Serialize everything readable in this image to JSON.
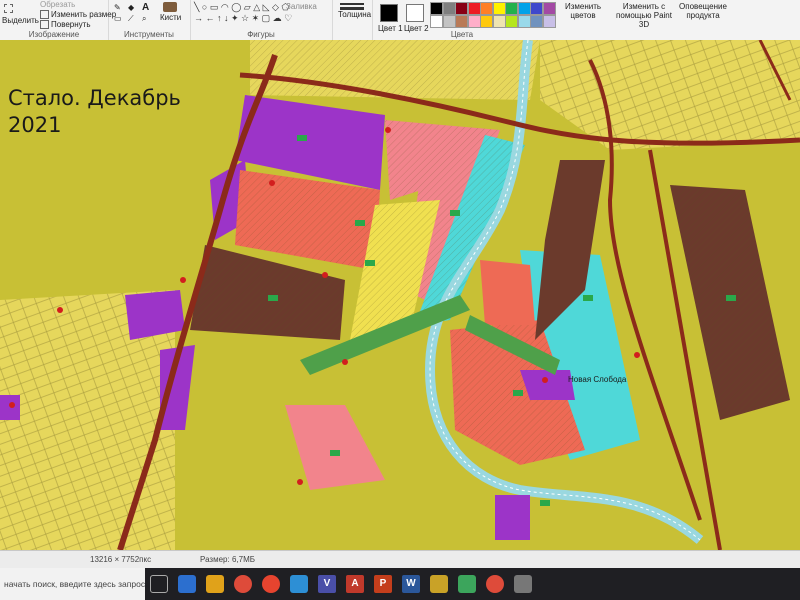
{
  "ribbon": {
    "image_group": {
      "label": "Изображение",
      "select": "Выделить",
      "crop": "Обрезать",
      "resize": "Изменить размер",
      "rotate": "Повернуть"
    },
    "tools_group": {
      "label": "Инструменты",
      "brushes": "Кисти",
      "text_tool": "A"
    },
    "shapes_group": {
      "label": "Фигуры",
      "fill": "Заливка"
    },
    "size": {
      "label": "Толщина"
    },
    "colors_group": {
      "label": "Цвета",
      "color1": "Цвет 1",
      "color2": "Цвет 2",
      "edit_colors": "Изменить цветов",
      "paint3d": "Изменить с помощью Paint 3D",
      "product_alert": "Оповещение продукта"
    },
    "palette": [
      "#000000",
      "#7f7f7f",
      "#880015",
      "#ed1c24",
      "#ff7f27",
      "#fff200",
      "#22b14c",
      "#00a2e8",
      "#3f48cc",
      "#a349a4",
      "#ffffff",
      "#c3c3c3",
      "#b97a57",
      "#ffaec9",
      "#ffc90e",
      "#efe4b0",
      "#b5e61d",
      "#99d9ea",
      "#7092be",
      "#c8bfe7"
    ]
  },
  "map": {
    "title_line1": "Стало. Декабрь",
    "title_line2": "2021",
    "place_label": "Новая Слобода",
    "colors": {
      "residential": "#e4d65a",
      "industrial": "#9c34c8",
      "commercial": "#ee6a55",
      "pink": "#f2848c",
      "cyan": "#4fd8d8",
      "brown": "#6b3a2c",
      "road": "#8b2a1a",
      "green": "#4fa04a",
      "background": "#c8c035"
    }
  },
  "status": {
    "dimensions": "13216 × 7752пкс",
    "size": "Размер: 6,7МБ"
  },
  "taskbar": {
    "search_placeholder": "начать поиск, введите здесь запрос"
  }
}
